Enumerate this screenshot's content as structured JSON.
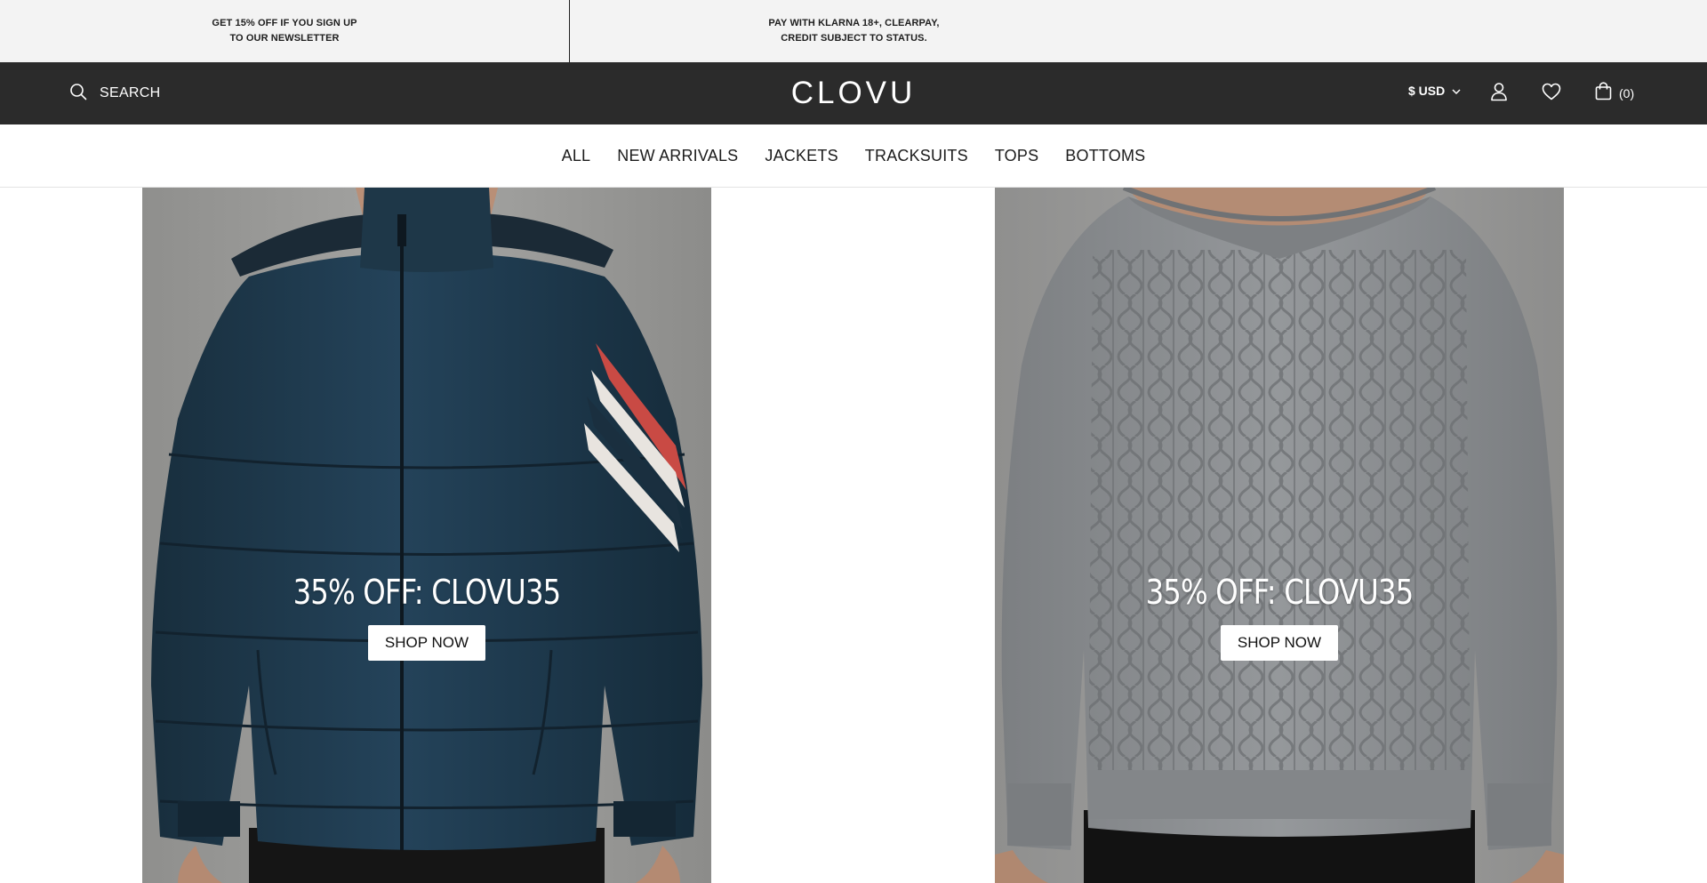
{
  "promo_bar": {
    "left_text": "GET 15% OFF IF YOU SIGN UP\nTO OUR NEWSLETTER",
    "right_text": "PAY WITH KLARNA 18+, CLEARPAY,\nCREDIT SUBJECT TO STATUS."
  },
  "header": {
    "search_label": "SEARCH",
    "logo": "CLOVU",
    "currency": "$ USD",
    "cart_count": "(0)",
    "icons": [
      "search-icon",
      "chevron-down-icon",
      "user-icon",
      "heart-icon",
      "shopping-bag-icon"
    ]
  },
  "nav": {
    "items": [
      {
        "label": "ALL"
      },
      {
        "label": "NEW ARRIVALS"
      },
      {
        "label": "JACKETS"
      },
      {
        "label": "TRACKSUITS"
      },
      {
        "label": "TOPS"
      },
      {
        "label": "BOTTOMS"
      }
    ]
  },
  "cards": [
    {
      "title": "35% OFF: CLOVU35",
      "button": "SHOP NOW",
      "colors": {
        "jacket": "#1f3a4d",
        "background": "#9c9c9a"
      }
    },
    {
      "title": "35% OFF: CLOVU35",
      "button": "SHOP NOW",
      "colors": {
        "sweater": "#8e9092",
        "background": "#9a9a99"
      }
    }
  ],
  "colors": {
    "promo_bg": "#f3f3f3",
    "header_bg": "#2b2b2b",
    "text_dark": "#1c1c1c"
  }
}
